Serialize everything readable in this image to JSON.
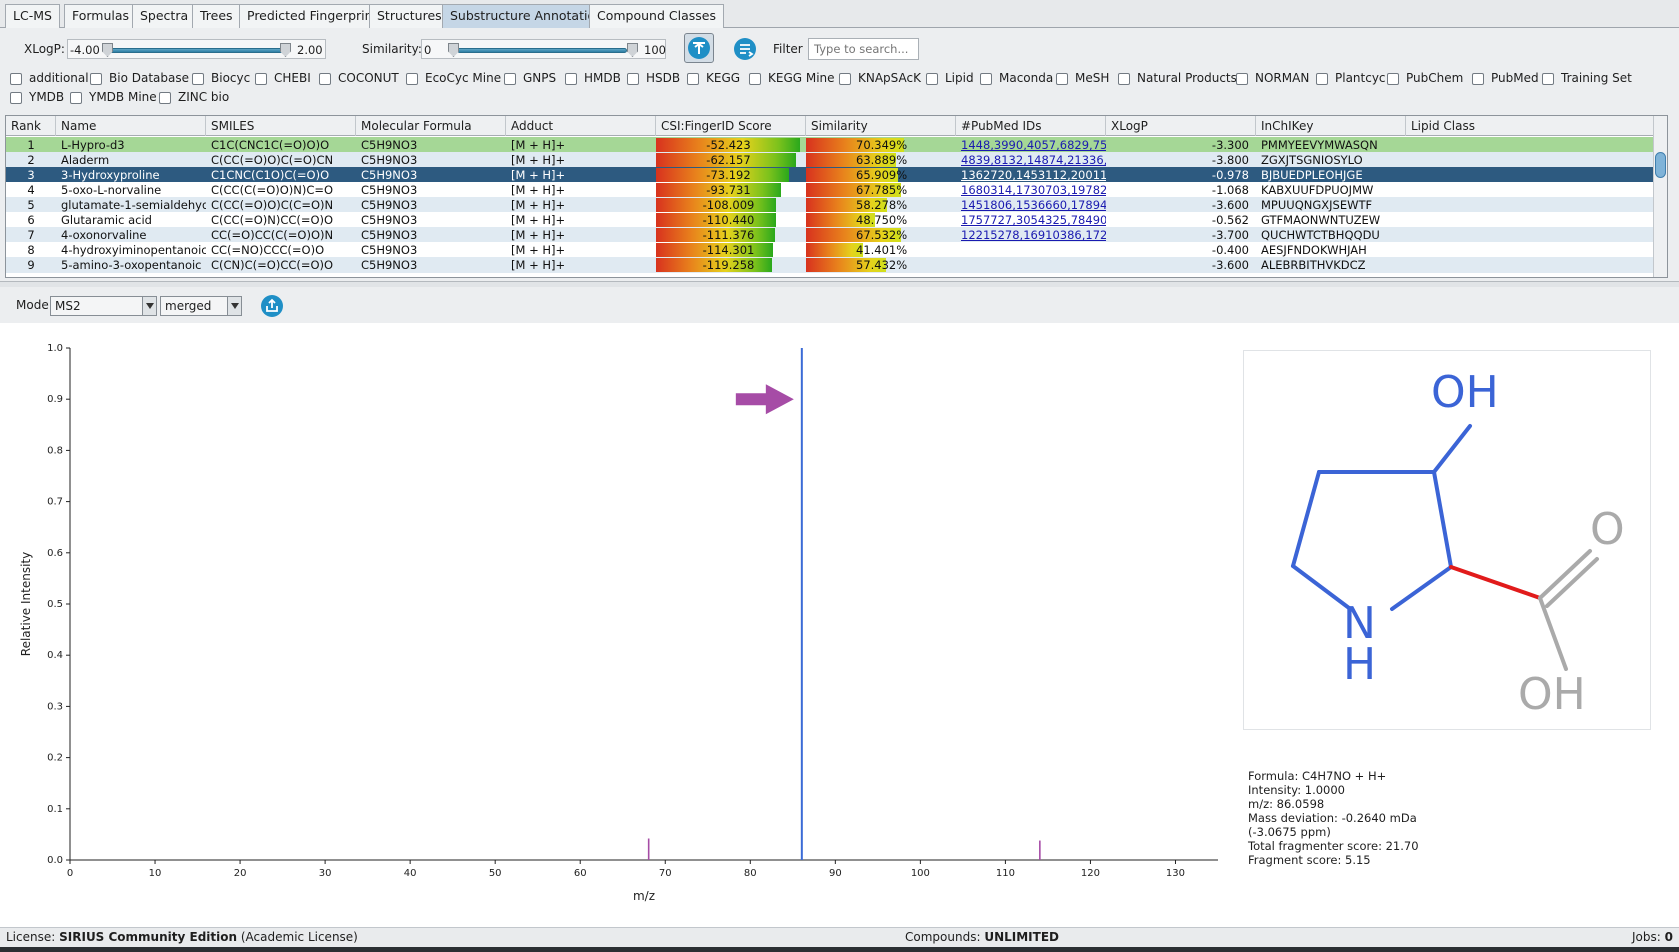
{
  "tabs": [
    {
      "label": "LC-MS",
      "active": false
    },
    {
      "label": "Formulas",
      "active": false
    },
    {
      "label": "Spectra",
      "active": false
    },
    {
      "label": "Trees",
      "active": false
    },
    {
      "label": "Predicted Fingerprint",
      "active": false
    },
    {
      "label": "Structures",
      "active": false
    },
    {
      "label": "Substructure Annotation",
      "active": true
    },
    {
      "label": "Compound Classes",
      "active": false
    }
  ],
  "toolbar": {
    "xlogp_label": "XLogP:",
    "xlogp_min": "-4.00",
    "xlogp_max": "2.00",
    "similarity_label": "Similarity:",
    "similarity_min": "0",
    "similarity_max": "100",
    "filter_label": "Filter",
    "filter_placeholder": "Type to search..."
  },
  "databases": [
    "additional",
    "Bio Database",
    "Biocyc",
    "CHEBI",
    "COCONUT",
    "EcoCyc Mine",
    "GNPS",
    "HMDB",
    "HSDB",
    "KEGG",
    "KEGG Mine",
    "KNApSAcK",
    "Lipid",
    "Maconda",
    "MeSH",
    "Natural Products",
    "NORMAN",
    "Plantcyc",
    "PubChem",
    "PubMed",
    "Training Set",
    "YMDB",
    "YMDB Mine",
    "ZINC bio"
  ],
  "table": {
    "columns": [
      "Rank",
      "Name",
      "SMILES",
      "Molecular Formula",
      "Adduct",
      "CSI:FingerID Score",
      "Similarity",
      "#PubMed IDs",
      "XLogP",
      "InChIKey",
      "Lipid Class"
    ],
    "rows": [
      {
        "rank": "1",
        "name": "L-Hypro-d3",
        "smiles": "C1C(CNC1C(=O)O)O",
        "formula": "C5H9NO3",
        "adduct": "[M + H]+",
        "score": "-52.423",
        "score_frac": 0.995,
        "similarity": "70.349%",
        "sim_frac": 0.7,
        "pubmed": "1448,3990,4057,6829,75...",
        "xlogp": "-3.300",
        "inchikey": "PMMYEEVYMWASQN",
        "lipid": "",
        "style": "top"
      },
      {
        "rank": "2",
        "name": "Aladerm",
        "smiles": "C(CC(=O)O)C(=O)CN",
        "formula": "C5H9NO3",
        "adduct": "[M + H]+",
        "score": "-62.157",
        "score_frac": 0.965,
        "similarity": "63.889%",
        "sim_frac": 0.64,
        "pubmed": "4839,8132,14874,21336,...",
        "xlogp": "-3.800",
        "inchikey": "ZGXJTSGNIOSYLO",
        "lipid": "",
        "style": "alt"
      },
      {
        "rank": "3",
        "name": "3-Hydroxyproline",
        "smiles": "C1CNC(C1O)C(=O)O",
        "formula": "C5H9NO3",
        "adduct": "[M + H]+",
        "score": "-73.192",
        "score_frac": 0.92,
        "similarity": "65.909%",
        "sim_frac": 0.66,
        "pubmed": "1362720,1453112,20011...",
        "xlogp": "-0.978",
        "inchikey": "BJBUEDPLEOHJGE",
        "lipid": "",
        "style": "selected"
      },
      {
        "rank": "4",
        "name": "5-oxo-L-norvaline",
        "smiles": "C(CC(C(=O)O)N)C=O",
        "formula": "C5H9NO3",
        "adduct": "[M + H]+",
        "score": "-93.731",
        "score_frac": 0.865,
        "similarity": "67.785%",
        "sim_frac": 0.68,
        "pubmed": "1680314,1730703,19782...",
        "xlogp": "-1.068",
        "inchikey": "KABXUUFDPUOJMW",
        "lipid": "",
        "style": "plain"
      },
      {
        "rank": "5",
        "name": "glutamate-1-semialdehyde",
        "smiles": "C(CC(=O)O)C(C=O)N",
        "formula": "C5H9NO3",
        "adduct": "[M + H]+",
        "score": "-108.009",
        "score_frac": 0.83,
        "similarity": "58.278%",
        "sim_frac": 0.58,
        "pubmed": "1451806,1536660,17894...",
        "xlogp": "-3.600",
        "inchikey": "MPUUQNGXJSEWTF",
        "lipid": "",
        "style": "alt"
      },
      {
        "rank": "6",
        "name": "Glutaramic acid",
        "smiles": "C(CC(=O)N)CC(=O)O",
        "formula": "C5H9NO3",
        "adduct": "[M + H]+",
        "score": "-110.440",
        "score_frac": 0.825,
        "similarity": "48.750%",
        "sim_frac": 0.49,
        "pubmed": "1757727,3054325,78490...",
        "xlogp": "-0.562",
        "inchikey": "GTFMAONWNTUZEW",
        "lipid": "",
        "style": "plain"
      },
      {
        "rank": "7",
        "name": "4-oxonorvaline",
        "smiles": "CC(=O)CC(C(=O)O)N",
        "formula": "C5H9NO3",
        "adduct": "[M + H]+",
        "score": "-111.376",
        "score_frac": 0.82,
        "similarity": "67.532%",
        "sim_frac": 0.68,
        "pubmed": "12215278,16910386,172...",
        "xlogp": "-3.700",
        "inchikey": "QUCHWTCTBHQQDU",
        "lipid": "",
        "style": "alt"
      },
      {
        "rank": "8",
        "name": "4-hydroxyiminopentanoic ...",
        "smiles": "CC(=NO)CCC(=O)O",
        "formula": "C5H9NO3",
        "adduct": "[M + H]+",
        "score": "-114.301",
        "score_frac": 0.81,
        "similarity": "41.401%",
        "sim_frac": 0.41,
        "pubmed": "",
        "xlogp": "-0.400",
        "inchikey": "AESJFNDOKWHJAH",
        "lipid": "",
        "style": "plain"
      },
      {
        "rank": "9",
        "name": "5-amino-3-oxopentanoic ...",
        "smiles": "C(CN)C(=O)CC(=O)O",
        "formula": "C5H9NO3",
        "adduct": "[M + H]+",
        "score": "-119.258",
        "score_frac": 0.8,
        "similarity": "57.432%",
        "sim_frac": 0.57,
        "pubmed": "",
        "xlogp": "-3.600",
        "inchikey": "ALEBRBITHVKDCZ",
        "lipid": "",
        "style": "alt"
      }
    ]
  },
  "modebar": {
    "mode_label": "Mode",
    "mode_value": "MS2",
    "merge_value": "merged"
  },
  "chart_data": {
    "type": "bar",
    "xlabel": "m/z",
    "ylabel": "Relative Intensity",
    "xlim": [
      0,
      135
    ],
    "ylim": [
      0,
      1.0
    ],
    "xticks": [
      0,
      10,
      20,
      30,
      40,
      50,
      60,
      70,
      80,
      90,
      100,
      110,
      120,
      130
    ],
    "yticks": [
      0.0,
      0.1,
      0.2,
      0.3,
      0.4,
      0.5,
      0.6,
      0.7,
      0.8,
      0.9,
      1.0
    ],
    "peaks": [
      {
        "mz": 68.05,
        "intensity": 0.042,
        "color": "#a64ca6"
      },
      {
        "mz": 86.06,
        "intensity": 1.0,
        "color": "#3b6bd6",
        "selected": true
      },
      {
        "mz": 114.05,
        "intensity": 0.038,
        "color": "#a64ca6"
      }
    ],
    "arrow_color": "#a64ca6"
  },
  "structure": {
    "atoms": {
      "oh_top": "OH",
      "o_carbonyl": "O",
      "oh_acid": "OH",
      "n": "N",
      "h": "H"
    },
    "colors": {
      "highlight": "#3b64d6",
      "bond_red": "#e11b1b",
      "unmatched": "#aaaaaa"
    }
  },
  "peak_info": {
    "formula": "Formula: C4H7NO + H+",
    "intensity": "Intensity: 1.0000",
    "mz": "m/z: 86.0598",
    "mass_dev": "Mass deviation: -0.2640 mDa",
    "mass_dev_ppm": "(-3.0675 ppm)",
    "total_score": "Total fragmenter score: 21.70",
    "fragment_score": "Fragment score: 5.15"
  },
  "status": {
    "license_label": "License:",
    "license_value": "SIRIUS Community Edition",
    "license_note": "(Academic License)",
    "compounds_label": "Compounds:",
    "compounds_value": "UNLIMITED",
    "jobs_label": "Jobs:",
    "jobs_value": "0"
  }
}
